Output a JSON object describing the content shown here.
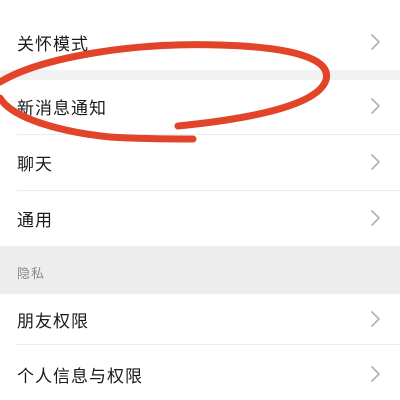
{
  "settings": {
    "care_mode": "关怀模式",
    "new_message_notifications": "新消息通知",
    "chat": "聊天",
    "general": "通用"
  },
  "privacy_section": {
    "header": "隐私",
    "friend_permissions": "朋友权限",
    "personal_info_permissions": "个人信息与权限"
  },
  "colors": {
    "annotation_stroke": "#e2442a",
    "chevron": "#b5b5b5",
    "section_background": "#ededed"
  },
  "icons": {
    "row_disclosure": "chevron-right-icon"
  }
}
